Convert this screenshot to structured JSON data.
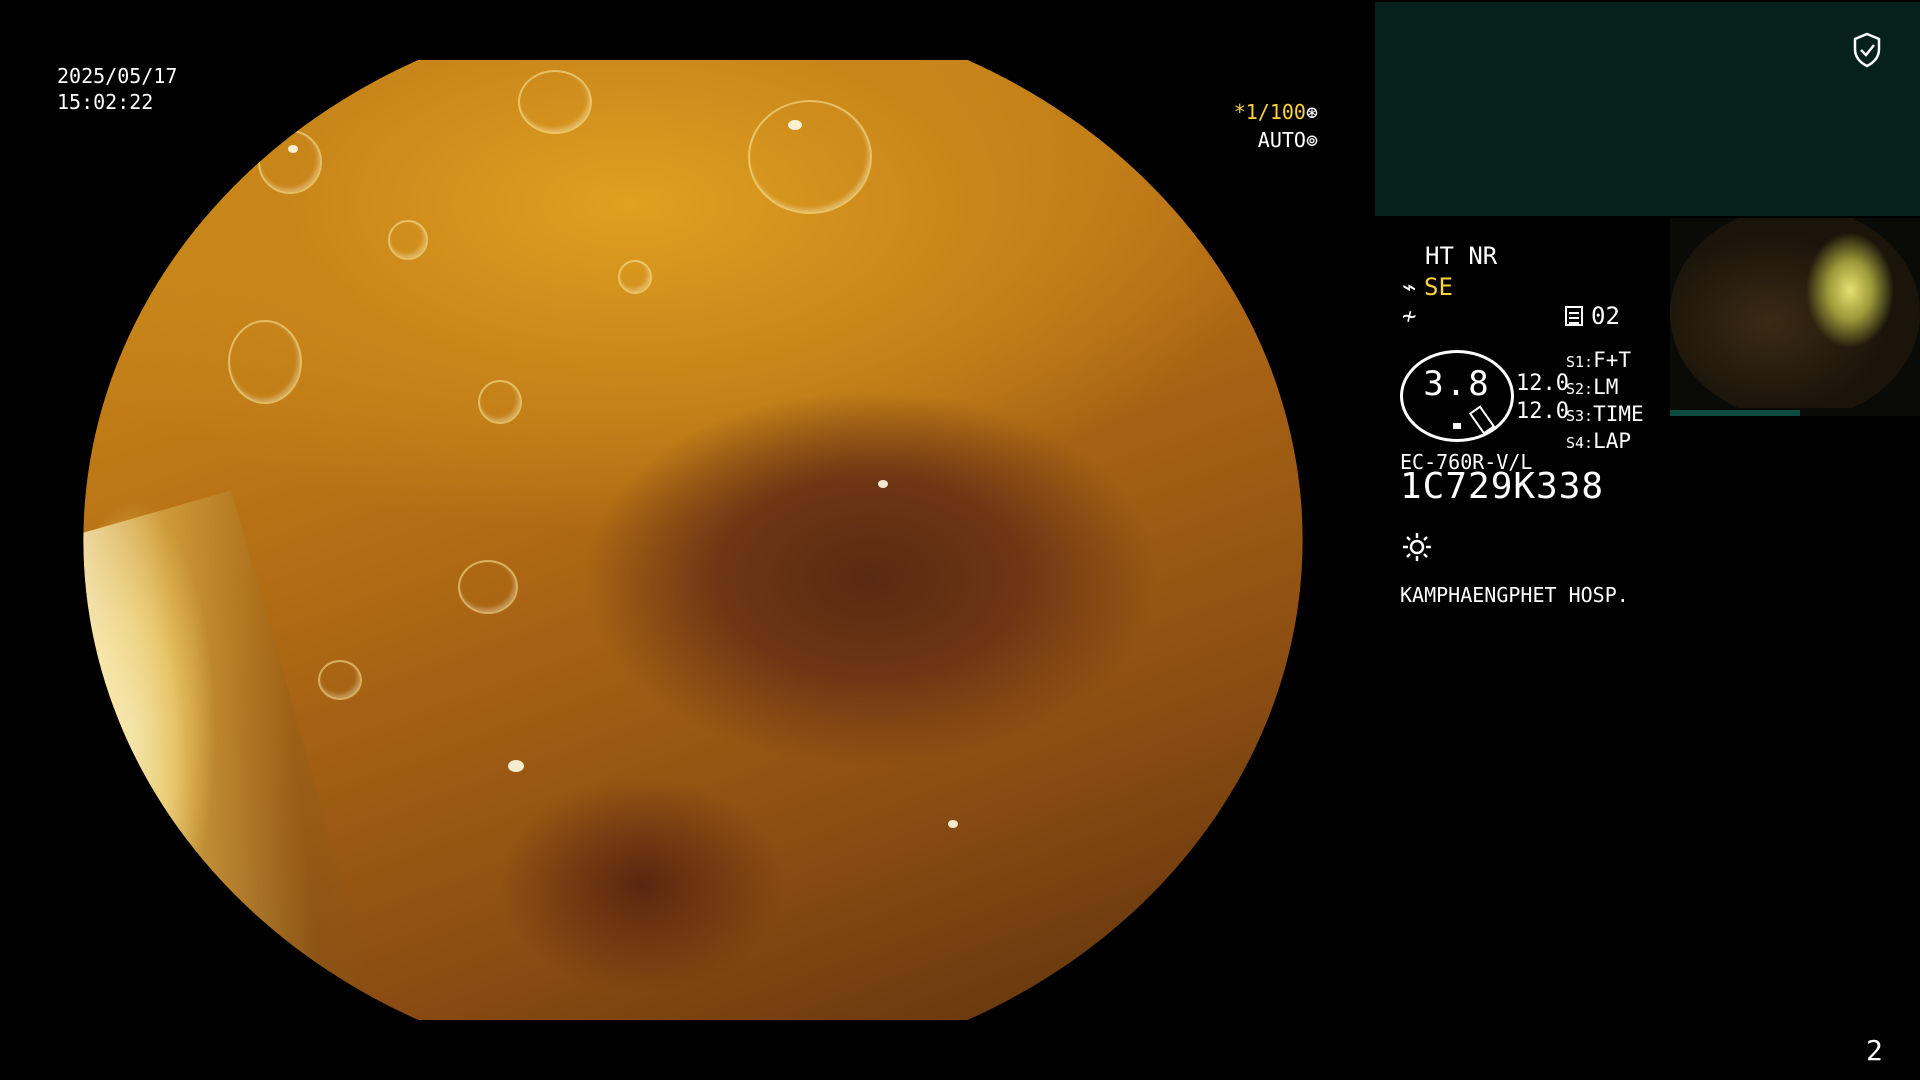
{
  "overlay": {
    "date": "2025/05/17",
    "time": "15:02:22",
    "shutter": "*1/100",
    "iris": "AUTO"
  },
  "panel": {
    "enhancement": "HT NR",
    "structure_mode": "SE",
    "color_mode_number": "02",
    "zoom_value": "3.8",
    "values": [
      "12.0",
      "12.0"
    ],
    "switches": [
      {
        "key": "S1:",
        "value": "F+T"
      },
      {
        "key": "S2:",
        "value": "LM"
      },
      {
        "key": "S3:",
        "value": "TIME"
      },
      {
        "key": "S4:",
        "value": "LAP"
      }
    ],
    "scope_model": "EC-760R-V/L",
    "serial": "1C729K338",
    "hospital": "KAMPHAENGPHET HOSP.",
    "page_number": "2"
  },
  "icons": {
    "shield": "shield-check-icon",
    "shutter": "shutter-icon",
    "iris": "iris-icon",
    "scope": "scope-icon",
    "wave": "wave-icon",
    "document": "document-icon",
    "light": "sun-icon"
  },
  "colors": {
    "accent_yellow": "#ffd23a",
    "panel_green": "#06201c"
  }
}
